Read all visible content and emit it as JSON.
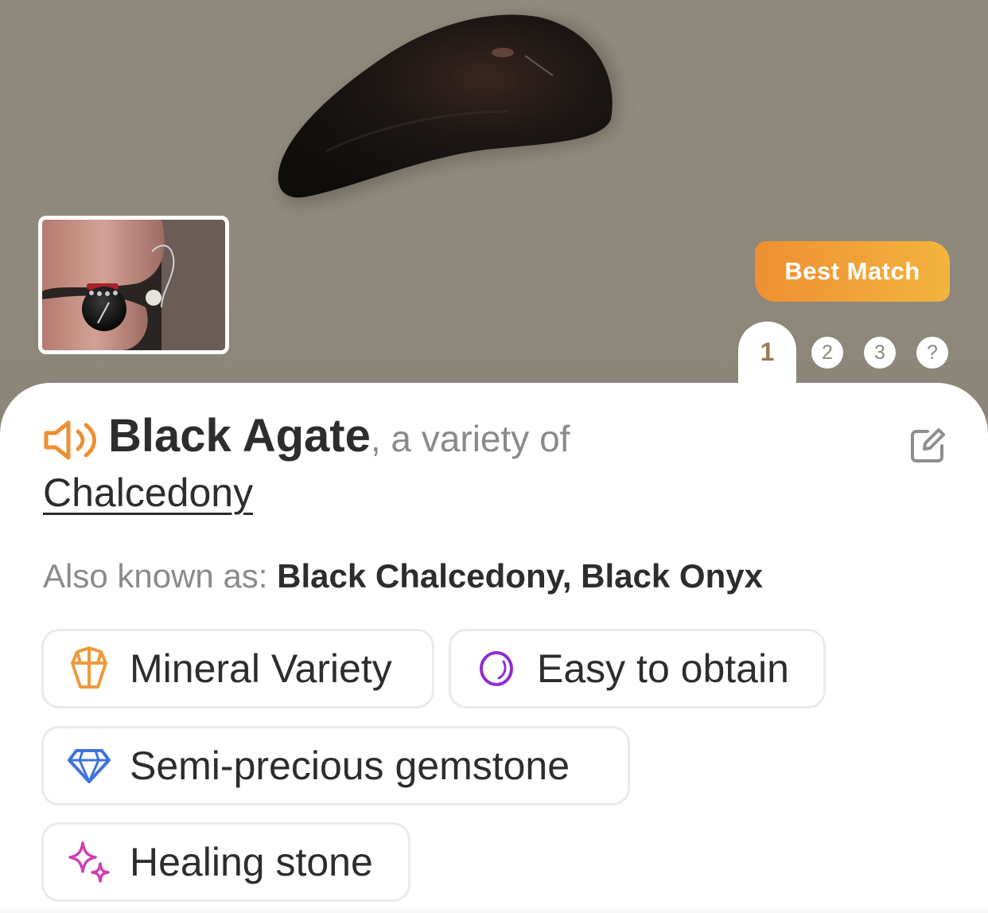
{
  "result": {
    "badge": "Best Match",
    "pager": {
      "active": "1",
      "pages": [
        "2",
        "3",
        "?"
      ]
    }
  },
  "identification": {
    "name": "Black Agate",
    "variety_text": ", a variety of",
    "species": "Chalcedony"
  },
  "aliases": {
    "label": "Also known as: ",
    "value": "Black Chalcedony, Black Onyx"
  },
  "tags": [
    {
      "label": "Mineral Variety",
      "icon": "crystal-icon",
      "color": "#ee9a3c"
    },
    {
      "label": "Easy to obtain",
      "icon": "stone-icon",
      "color": "#8f2fcf"
    },
    {
      "label": "Semi-precious gemstone",
      "icon": "diamond-icon",
      "color": "#3f74e0"
    },
    {
      "label": "Healing stone",
      "icon": "sparkle-icon",
      "color": "#cf3fb5"
    }
  ],
  "colors": {
    "accent": "#ee8f33",
    "badge_end": "#f3b43e",
    "text_primary": "#2d2d2d",
    "text_secondary": "#8a8a8a"
  }
}
